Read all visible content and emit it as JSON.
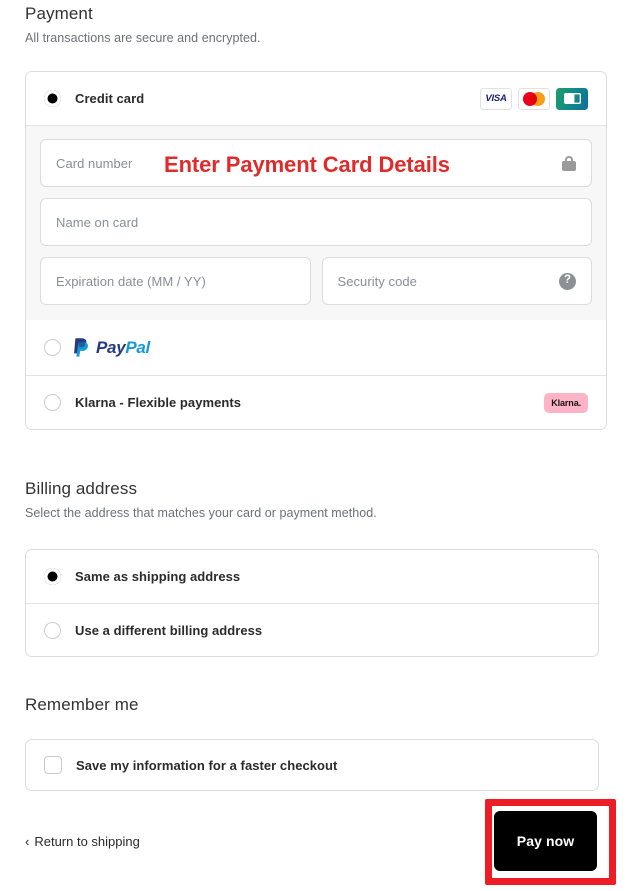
{
  "payment": {
    "title": "Payment",
    "subtitle": "All transactions are secure and encrypted.",
    "methods": [
      {
        "label": "Credit card",
        "selected": true
      },
      {
        "label": "PayPal",
        "selected": false
      },
      {
        "label": "Klarna - Flexible payments",
        "selected": false,
        "badge": "Klarna."
      }
    ],
    "brands": [
      "VISA",
      "mastercard-icon",
      "cb-icon"
    ],
    "visa_text": "VISA",
    "fields": {
      "card_number_placeholder": "Card number",
      "name_on_card_placeholder": "Name on card",
      "expiration_placeholder": "Expiration date (MM / YY)",
      "security_code_placeholder": "Security code",
      "help_glyph": "?"
    },
    "paypal_logo": {
      "part1": "Pay",
      "part2": "Pal"
    }
  },
  "annotations": {
    "card_details_text": "Enter Payment Card Details",
    "text_color": "#e02b2b",
    "box_color": "#ee1c25",
    "highlighted_target": "pay-now-button"
  },
  "billing": {
    "title": "Billing address",
    "subtitle": "Select the address that matches your card or payment method.",
    "options": [
      {
        "label": "Same as shipping address",
        "selected": true
      },
      {
        "label": "Use a different billing address",
        "selected": false
      }
    ]
  },
  "remember": {
    "title": "Remember me",
    "option_label": "Save my information for a faster checkout",
    "checked": false
  },
  "footer": {
    "return_chevron": "‹",
    "return_label": "Return to shipping",
    "pay_label": "Pay now"
  }
}
